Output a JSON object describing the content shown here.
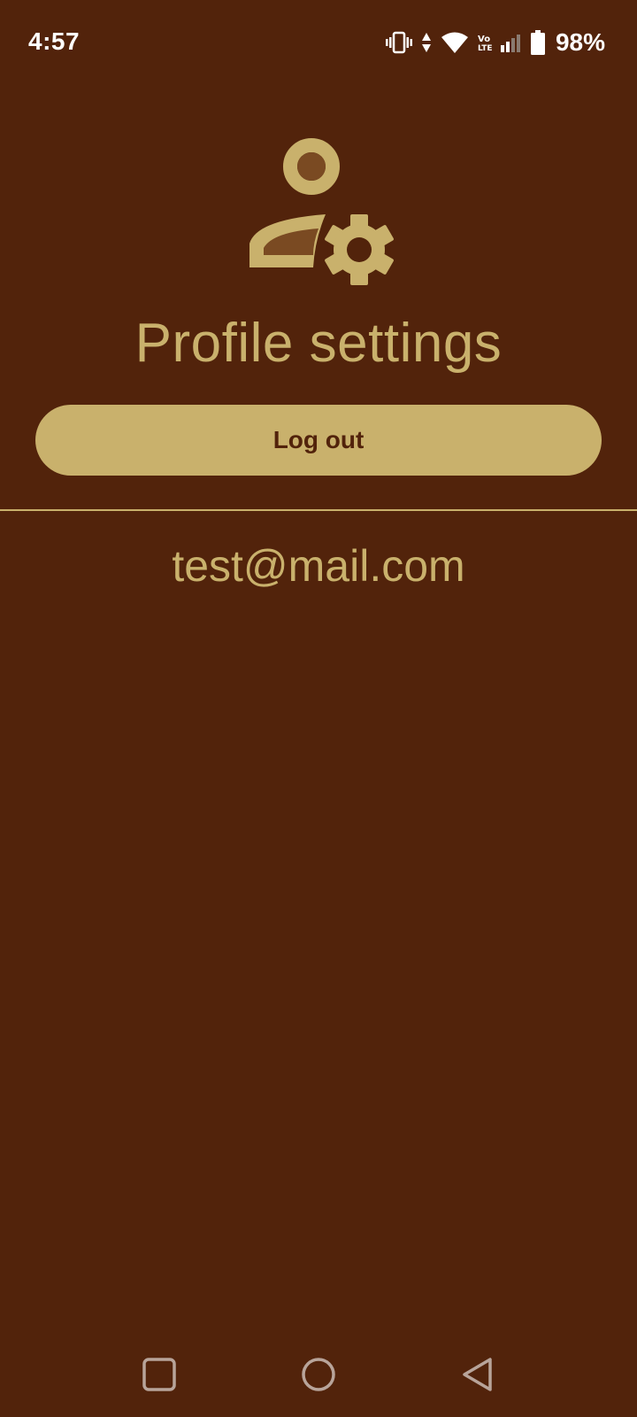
{
  "status_bar": {
    "time": "4:57",
    "battery_percent": "98%",
    "icons": [
      "vibrate-icon",
      "data-arrows-icon",
      "wifi-icon",
      "volte-icon",
      "cell-signal-icon",
      "battery-icon"
    ]
  },
  "header": {
    "icon": "manage-accounts-icon",
    "title": "Profile settings"
  },
  "actions": {
    "logout_label": "Log out"
  },
  "account": {
    "email": "test@mail.com"
  },
  "nav_bar": {
    "buttons": [
      "recents-icon",
      "home-icon",
      "back-icon"
    ]
  },
  "colors": {
    "background": "#52230b",
    "accent": "#c9b16c",
    "status_text": "#ffffff"
  }
}
